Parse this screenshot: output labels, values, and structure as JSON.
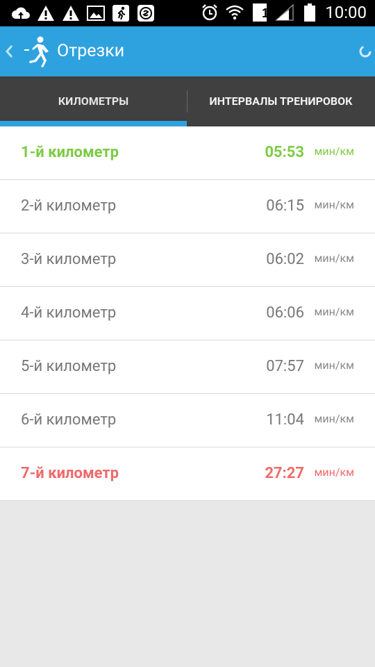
{
  "status_bar": {
    "time": "10:00",
    "sim_label": "1",
    "icons_left": [
      "cloud-upload-icon",
      "warning-icon",
      "warning-icon",
      "image-icon",
      "runner-icon",
      "shazam-icon"
    ],
    "icons_right": [
      "alarm-icon",
      "wifi-icon",
      "sim-icon",
      "signal-icon",
      "battery-icon"
    ]
  },
  "action_bar": {
    "title": "Отрезки",
    "back_icon": "chevron-left-icon",
    "logo_icon": "runner-icon",
    "background": "#2ea2de"
  },
  "tabs": [
    {
      "label": "КИЛОМЕТРЫ",
      "selected": true
    },
    {
      "label": "ИНТЕРВАЛЫ ТРЕНИРОВОК",
      "selected": false
    }
  ],
  "splits": [
    {
      "label": "1-й километр",
      "time": "05:53",
      "unit": "мин/км",
      "highlight": "fastest"
    },
    {
      "label": "2-й километр",
      "time": "06:15",
      "unit": "мин/км",
      "highlight": "none"
    },
    {
      "label": "3-й километр",
      "time": "06:02",
      "unit": "мин/км",
      "highlight": "none"
    },
    {
      "label": "4-й километр",
      "time": "06:06",
      "unit": "мин/км",
      "highlight": "none"
    },
    {
      "label": "5-й километр",
      "time": "07:57",
      "unit": "мин/км",
      "highlight": "none"
    },
    {
      "label": "6-й километр",
      "time": "11:04",
      "unit": "мин/км",
      "highlight": "none"
    },
    {
      "label": "7-й километр",
      "time": "27:27",
      "unit": "мин/км",
      "highlight": "slowest"
    }
  ],
  "colors": {
    "accent": "#2ea2de",
    "fastest": "#7dcb44",
    "slowest": "#ef6a6a"
  }
}
